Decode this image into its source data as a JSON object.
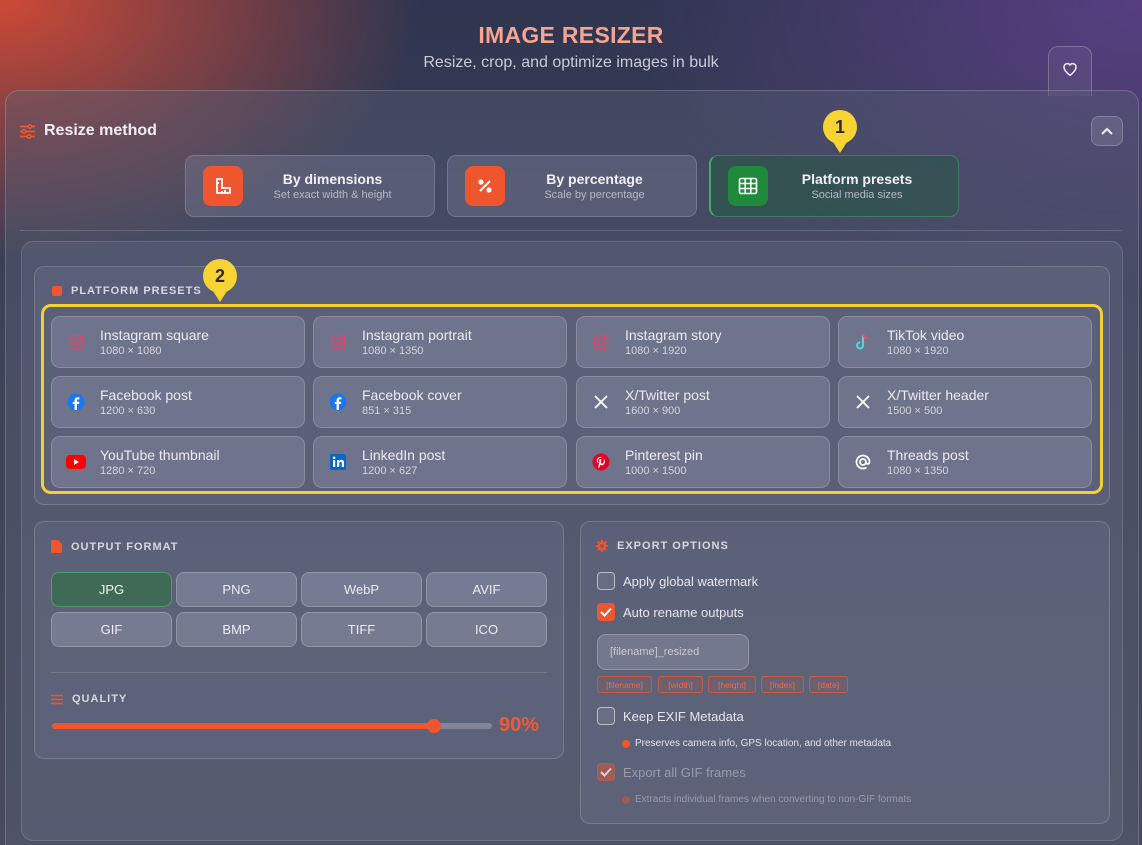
{
  "header": {
    "title": "IMAGE RESIZER",
    "subtitle": "Resize, crop, and optimize images in bulk"
  },
  "resize_method": {
    "title": "Resize method",
    "methods": [
      {
        "label": "By dimensions",
        "desc": "Set exact width & height",
        "icon": "ruler-icon"
      },
      {
        "label": "By percentage",
        "desc": "Scale by percentage",
        "icon": "percent-icon"
      },
      {
        "label": "Platform presets",
        "desc": "Social media sizes",
        "icon": "grid-icon",
        "active": true
      }
    ]
  },
  "callouts": [
    "1",
    "2"
  ],
  "presets": {
    "label": "PLATFORM PRESETS",
    "items": [
      {
        "name": "Instagram square",
        "size": "1080 × 1080",
        "icon": "instagram-icon"
      },
      {
        "name": "Instagram portrait",
        "size": "1080 × 1350",
        "icon": "instagram-icon"
      },
      {
        "name": "Instagram story",
        "size": "1080 × 1920",
        "icon": "instagram-icon"
      },
      {
        "name": "TikTok video",
        "size": "1080 × 1920",
        "icon": "tiktok-icon"
      },
      {
        "name": "Facebook post",
        "size": "1200 × 630",
        "icon": "facebook-icon"
      },
      {
        "name": "Facebook cover",
        "size": "851 × 315",
        "icon": "facebook-icon"
      },
      {
        "name": "X/Twitter post",
        "size": "1600 × 900",
        "icon": "x-icon"
      },
      {
        "name": "X/Twitter header",
        "size": "1500 × 500",
        "icon": "x-icon"
      },
      {
        "name": "YouTube thumbnail",
        "size": "1280 × 720",
        "icon": "youtube-icon"
      },
      {
        "name": "LinkedIn post",
        "size": "1200 × 627",
        "icon": "linkedin-icon"
      },
      {
        "name": "Pinterest pin",
        "size": "1000 × 1500",
        "icon": "pinterest-icon"
      },
      {
        "name": "Threads post",
        "size": "1080 × 1350",
        "icon": "threads-icon"
      }
    ]
  },
  "output_format": {
    "label": "OUTPUT FORMAT",
    "formats": [
      "JPG",
      "PNG",
      "WebP",
      "AVIF",
      "GIF",
      "BMP",
      "TIFF",
      "ICO"
    ],
    "selected": "JPG"
  },
  "quality": {
    "label": "QUALITY",
    "value": 90,
    "display": "90%"
  },
  "export": {
    "label": "EXPORT OPTIONS",
    "watermark": {
      "label": "Apply global watermark",
      "checked": false
    },
    "rename": {
      "label": "Auto rename outputs",
      "checked": true,
      "placeholder": "[filename]_resized"
    },
    "tokens": [
      "[filename]",
      "[width]",
      "[height]",
      "[index]",
      "[date]"
    ],
    "exif": {
      "label": "Keep EXIF Metadata",
      "checked": false,
      "note": "Preserves camera info, GPS location, and other metadata"
    },
    "gif": {
      "label": "Export all GIF frames",
      "checked": true,
      "disabled": true,
      "note": "Extracts individual frames when converting to non-GIF formats"
    }
  },
  "colors": {
    "accent": "#ef5630",
    "active_green": "#1f8a3c",
    "callout_yellow": "#f5d130"
  }
}
